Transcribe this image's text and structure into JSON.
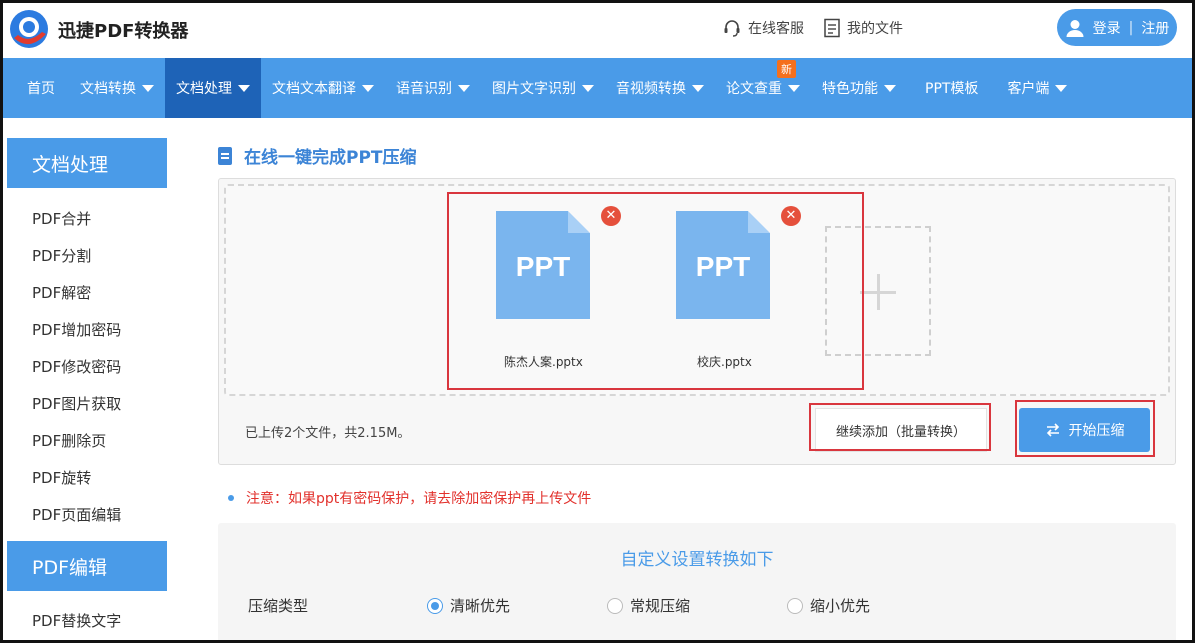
{
  "header": {
    "brand": "迅捷PDF转换器",
    "online_service": "在线客服",
    "my_files": "我的文件",
    "login": "登录",
    "register": "注册"
  },
  "nav": {
    "items": [
      {
        "label": "首页",
        "dropdown": false
      },
      {
        "label": "文档转换",
        "dropdown": true
      },
      {
        "label": "文档处理",
        "dropdown": true,
        "active": true
      },
      {
        "label": "文档文本翻译",
        "dropdown": true
      },
      {
        "label": "语音识别",
        "dropdown": true
      },
      {
        "label": "图片文字识别",
        "dropdown": true
      },
      {
        "label": "音视频转换",
        "dropdown": true
      },
      {
        "label": "论文查重",
        "dropdown": true,
        "badge": "新"
      },
      {
        "label": "特色功能",
        "dropdown": true
      },
      {
        "label": "PPT模板",
        "dropdown": false
      },
      {
        "label": "客户端",
        "dropdown": true
      }
    ]
  },
  "sidebar": {
    "section1_title": "文档处理",
    "section1_items": [
      "PDF合并",
      "PDF分割",
      "PDF解密",
      "PDF增加密码",
      "PDF修改密码",
      "PDF图片获取",
      "PDF删除页",
      "PDF旋转",
      "PDF页面编辑"
    ],
    "section2_title": "PDF编辑",
    "section2_items": [
      "PDF替换文字"
    ]
  },
  "main": {
    "title": "在线一键完成PPT压缩",
    "files": [
      {
        "name": "陈杰人案.pptx",
        "icon_label": "PPT"
      },
      {
        "name": "校庆.pptx",
        "icon_label": "PPT"
      }
    ],
    "upload_info": "已上传2个文件，共2.15M。",
    "continue_button": "继续添加（批量转换）",
    "start_button": "开始压缩",
    "notice": "注意：如果ppt有密码保护，请去除加密保护再上传文件",
    "settings_title": "自定义设置转换如下",
    "compression_label": "压缩类型",
    "options": [
      {
        "label": "清晰优先",
        "checked": true
      },
      {
        "label": "常规压缩",
        "checked": false
      },
      {
        "label": "缩小优先",
        "checked": false
      }
    ]
  },
  "colors": {
    "primary": "#4a9be8",
    "nav_active": "#1e63b7",
    "highlight_box": "#d9363e",
    "notice": "#e2312c",
    "new_badge": "#f5701d"
  }
}
